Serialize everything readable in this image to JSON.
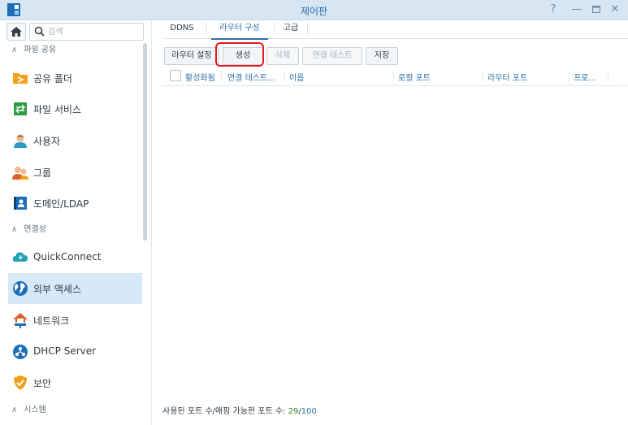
{
  "window": {
    "title": "제어판"
  },
  "sidebar": {
    "search_placeholder": "검색",
    "sections": [
      {
        "label": "파일 공유"
      },
      {
        "label": "연결성"
      },
      {
        "label": "시스템"
      }
    ],
    "items": [
      {
        "label": "공유 폴더"
      },
      {
        "label": "파일 서비스"
      },
      {
        "label": "사용자"
      },
      {
        "label": "그룹"
      },
      {
        "label": "도메인/LDAP"
      },
      {
        "label": "QuickConnect"
      },
      {
        "label": "외부 액세스"
      },
      {
        "label": "네트워크"
      },
      {
        "label": "DHCP Server"
      },
      {
        "label": "보안"
      }
    ]
  },
  "main": {
    "tabs": [
      {
        "label": "DDNS"
      },
      {
        "label": "라우터 구성"
      },
      {
        "label": "고급"
      }
    ],
    "toolbar": {
      "router_settings": "라우터 설정",
      "create": "생성",
      "delete": "삭제",
      "test_connection": "연결 테스트",
      "save": "저장"
    },
    "columns": [
      "활성화됨",
      "연결 테스트...",
      "이름",
      "로컬 포트",
      "라우터 포트",
      "프로..."
    ],
    "footer": {
      "label": "사용된 포트 수/매핑 가능한 포트 수: ",
      "used": "29",
      "slash": "/",
      "max": "100"
    }
  },
  "colors": {
    "accent": "#2f6fa8",
    "active_row": "#d7e8f6",
    "highlight_ring": "#e8161d",
    "used_ports": "#2b8a2b"
  }
}
